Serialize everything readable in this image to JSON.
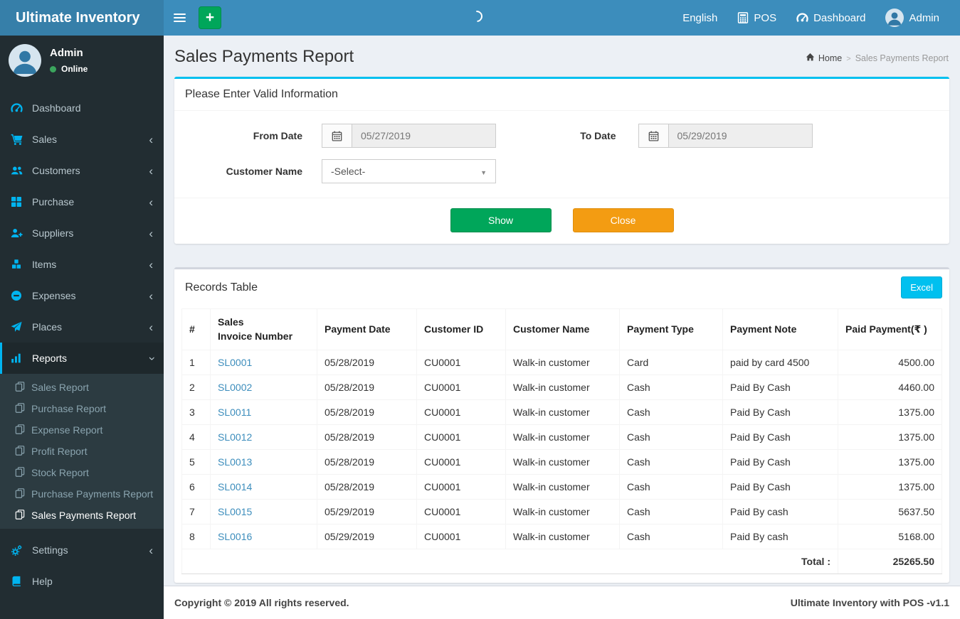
{
  "header": {
    "brand": "Ultimate Inventory",
    "language": "English",
    "pos": "POS",
    "dashboard": "Dashboard",
    "user": "Admin"
  },
  "sidebar": {
    "user": {
      "name": "Admin",
      "status": "Online"
    },
    "items": [
      {
        "label": "Dashboard",
        "icon": "gauge-icon",
        "chevron": false
      },
      {
        "label": "Sales",
        "icon": "cart-icon",
        "chevron": true
      },
      {
        "label": "Customers",
        "icon": "users-icon",
        "chevron": true
      },
      {
        "label": "Purchase",
        "icon": "grid-icon",
        "chevron": true
      },
      {
        "label": "Suppliers",
        "icon": "user-plus-icon",
        "chevron": true
      },
      {
        "label": "Items",
        "icon": "cubes-icon",
        "chevron": true
      },
      {
        "label": "Expenses",
        "icon": "minus-circle-icon",
        "chevron": true
      },
      {
        "label": "Places",
        "icon": "paper-plane-icon",
        "chevron": true
      },
      {
        "label": "Reports",
        "icon": "bar-chart-icon",
        "chevron": "down",
        "active": true
      }
    ],
    "reports_submenu": [
      {
        "label": "Sales Report",
        "active": false
      },
      {
        "label": "Purchase Report",
        "active": false
      },
      {
        "label": "Expense Report",
        "active": false
      },
      {
        "label": "Profit Report",
        "active": false
      },
      {
        "label": "Stock Report",
        "active": false
      },
      {
        "label": "Purchase Payments Report",
        "active": false
      },
      {
        "label": "Sales Payments Report",
        "active": true
      }
    ],
    "settings_label": "Settings",
    "help_label": "Help"
  },
  "page": {
    "title": "Sales Payments Report",
    "breadcrumb_home": "Home",
    "breadcrumb_current": "Sales Payments Report"
  },
  "filter": {
    "title": "Please Enter Valid Information",
    "from_label": "From Date",
    "from_value": "05/27/2019",
    "to_label": "To Date",
    "to_value": "05/29/2019",
    "customer_label": "Customer Name",
    "customer_value": "-Select-",
    "show_label": "Show",
    "close_label": "Close"
  },
  "records": {
    "title": "Records Table",
    "excel_label": "Excel",
    "columns": [
      "#",
      "Sales\nInvoice Number",
      "Payment Date",
      "Customer ID",
      "Customer Name",
      "Payment Type",
      "Payment Note",
      "Paid Payment(₹ )"
    ],
    "rows": [
      [
        "1",
        "SL0001",
        "05/28/2019",
        "CU0001",
        "Walk-in customer",
        "Card",
        "paid by card 4500",
        "4500.00"
      ],
      [
        "2",
        "SL0002",
        "05/28/2019",
        "CU0001",
        "Walk-in customer",
        "Cash",
        "Paid By Cash",
        "4460.00"
      ],
      [
        "3",
        "SL0011",
        "05/28/2019",
        "CU0001",
        "Walk-in customer",
        "Cash",
        "Paid By Cash",
        "1375.00"
      ],
      [
        "4",
        "SL0012",
        "05/28/2019",
        "CU0001",
        "Walk-in customer",
        "Cash",
        "Paid By Cash",
        "1375.00"
      ],
      [
        "5",
        "SL0013",
        "05/28/2019",
        "CU0001",
        "Walk-in customer",
        "Cash",
        "Paid By Cash",
        "1375.00"
      ],
      [
        "6",
        "SL0014",
        "05/28/2019",
        "CU0001",
        "Walk-in customer",
        "Cash",
        "Paid By Cash",
        "1375.00"
      ],
      [
        "7",
        "SL0015",
        "05/29/2019",
        "CU0001",
        "Walk-in customer",
        "Cash",
        "Paid By cash",
        "5637.50"
      ],
      [
        "8",
        "SL0016",
        "05/29/2019",
        "CU0001",
        "Walk-in customer",
        "Cash",
        "Paid By cash",
        "5168.00"
      ]
    ],
    "total_label": "Total :",
    "total_value": "25265.50"
  },
  "footer": {
    "left": "Copyright © 2019 All rights reserved.",
    "right": "Ultimate Inventory with POS -v1.1"
  },
  "colors": {
    "navbar": "#3c8dbc",
    "logo_bg": "#367fa9",
    "accent_cyan": "#00c0ef",
    "green": "#00a65a",
    "orange": "#f39c12",
    "sidebar_bg": "#222d32",
    "icon_blue": "#00b4f0"
  }
}
